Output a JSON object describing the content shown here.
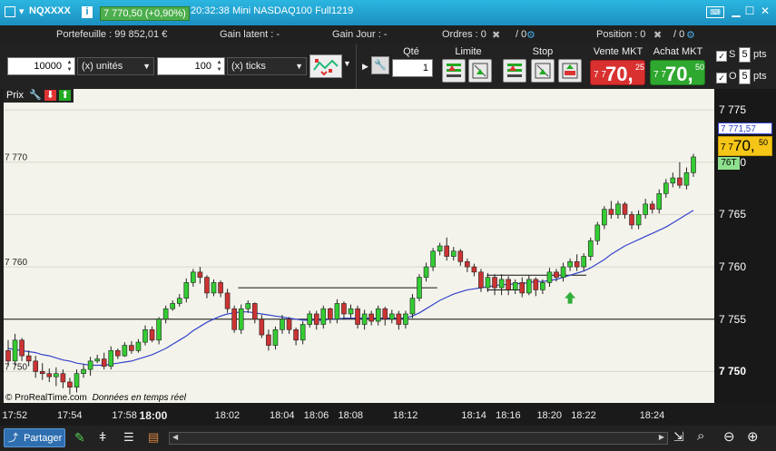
{
  "window": {
    "symbol": "NQXXXX",
    "price_badge": "7 770,50 (+0,90%)",
    "time": "20:32:38",
    "instrument": "Mini NASDAQ100 Full1219"
  },
  "account": {
    "portefeuille": "Portefeuille : 99 852,01 €",
    "gain_latent": "Gain latent : -",
    "gain_jour": "Gain Jour : -",
    "ordres": "Ordres : 0",
    "ordres2": "/ 0",
    "position": "Position : 0",
    "position2": "/ 0"
  },
  "toolbar": {
    "amount": "10000",
    "unit": "(x) unités",
    "ticks_value": "100",
    "ticks_unit": "(x) ticks",
    "qte_label": "Qté",
    "qte_value": "1",
    "limite_label": "Limite",
    "stop_label": "Stop",
    "vente_label": "Vente MKT",
    "vente_small": "7 7",
    "vente_big": "70,",
    "vente_sup": "25",
    "achat_label": "Achat MKT",
    "achat_small": "7 7",
    "achat_big": "70,",
    "achat_sup": "50",
    "s_label": "S",
    "s_value": "5",
    "o_label": "O",
    "o_value": "5",
    "pts": "pts"
  },
  "chart_panel": {
    "prix_label": "Prix",
    "credit": "© ProRealTime.com",
    "credit_live": "Données en temps réel",
    "price_tag_blue": "7 771,57",
    "price_tag_yellow_small": "7 7",
    "price_tag_yellow_big": "70,",
    "price_tag_yellow_sup": "50",
    "timer_tag": "76T"
  },
  "colors": {
    "up": "#33cc33",
    "down": "#cc3333",
    "ma": "#3344cc",
    "vente": "#d93030",
    "achat": "#2fa82f",
    "accent": "#1b8fc0"
  },
  "bottom": {
    "share_label": "Partager"
  },
  "chart_data": {
    "type": "candlestick",
    "ylim": [
      7747,
      7777
    ],
    "y_ticks": [
      {
        "v": 7775,
        "label": "7 775"
      },
      {
        "v": 7770,
        "label": "7 770"
      },
      {
        "v": 7765,
        "label": "7 765"
      },
      {
        "v": 7760,
        "label": "7 760"
      },
      {
        "v": 7755,
        "label": "7 755"
      },
      {
        "v": 7750,
        "label": "7 750"
      }
    ],
    "left_labels": [
      {
        "v": 7770,
        "label": "7 770"
      },
      {
        "v": 7760,
        "label": "7 760"
      },
      {
        "v": 7750,
        "label": "7 750"
      }
    ],
    "x_ticks": [
      {
        "i": 1,
        "label": "17:52"
      },
      {
        "i": 9,
        "label": "17:54"
      },
      {
        "i": 17,
        "label": "17:58"
      },
      {
        "i": 21,
        "label": "18:00"
      },
      {
        "i": 32,
        "label": "18:02"
      },
      {
        "i": 40,
        "label": "18:04"
      },
      {
        "i": 45,
        "label": "18:06"
      },
      {
        "i": 50,
        "label": "18:08"
      },
      {
        "i": 58,
        "label": "18:12"
      },
      {
        "i": 68,
        "label": "18:14"
      },
      {
        "i": 73,
        "label": "18:16"
      },
      {
        "i": 79,
        "label": "18:20"
      },
      {
        "i": 84,
        "label": "18:22"
      },
      {
        "i": 94,
        "label": "18:24"
      }
    ],
    "candles": [
      [
        7752.0,
        7751.0,
        7753.0,
        7750.5
      ],
      [
        7751.0,
        7753.0,
        7753.6,
        7750.6
      ],
      [
        7753.0,
        7751.5,
        7753.2,
        7751.0
      ],
      [
        7751.5,
        7751.0,
        7752.0,
        7750.5
      ],
      [
        7751.0,
        7750.0,
        7751.5,
        7749.4
      ],
      [
        7750.0,
        7749.8,
        7750.8,
        7749.2
      ],
      [
        7749.8,
        7749.5,
        7750.3,
        7749.0
      ],
      [
        7749.5,
        7749.8,
        7750.4,
        7748.6
      ],
      [
        7749.8,
        7749.0,
        7750.2,
        7748.4
      ],
      [
        7749.0,
        7748.5,
        7749.4,
        7747.8
      ],
      [
        7748.5,
        7749.8,
        7750.2,
        7748.0
      ],
      [
        7749.8,
        7750.2,
        7750.7,
        7749.4
      ],
      [
        7750.2,
        7751.0,
        7751.4,
        7749.6
      ],
      [
        7751.0,
        7751.2,
        7751.6,
        7750.8
      ],
      [
        7751.2,
        7750.5,
        7751.8,
        7750.2
      ],
      [
        7750.5,
        7752.0,
        7752.4,
        7750.2
      ],
      [
        7752.0,
        7751.5,
        7752.2,
        7751.2
      ],
      [
        7751.5,
        7752.5,
        7752.8,
        7751.4
      ],
      [
        7752.5,
        7752.0,
        7752.9,
        7751.7
      ],
      [
        7752.0,
        7752.8,
        7753.1,
        7751.8
      ],
      [
        7752.8,
        7754.0,
        7754.4,
        7752.5
      ],
      [
        7754.0,
        7753.0,
        7754.3,
        7752.8
      ],
      [
        7753.0,
        7755.0,
        7755.2,
        7752.6
      ],
      [
        7755.0,
        7756.0,
        7756.3,
        7754.6
      ],
      [
        7756.0,
        7756.5,
        7756.8,
        7755.8
      ],
      [
        7756.5,
        7757.0,
        7757.4,
        7756.2
      ],
      [
        7757.0,
        7758.5,
        7758.9,
        7756.6
      ],
      [
        7758.5,
        7759.5,
        7759.8,
        7758.1
      ],
      [
        7759.5,
        7759.0,
        7760.0,
        7758.4
      ],
      [
        7759.0,
        7757.5,
        7759.2,
        7757.0
      ],
      [
        7757.5,
        7758.5,
        7758.8,
        7757.2
      ],
      [
        7758.5,
        7757.5,
        7758.7,
        7757.1
      ],
      [
        7757.5,
        7756.0,
        7757.9,
        7755.6
      ],
      [
        7756.0,
        7754.0,
        7756.3,
        7753.7
      ],
      [
        7754.0,
        7756.0,
        7756.4,
        7753.6
      ],
      [
        7756.0,
        7756.5,
        7756.8,
        7755.6
      ],
      [
        7756.5,
        7755.0,
        7756.6,
        7754.6
      ],
      [
        7755.0,
        7753.5,
        7755.4,
        7753.2
      ],
      [
        7753.5,
        7752.5,
        7754.0,
        7752.0
      ],
      [
        7752.5,
        7754.0,
        7754.3,
        7752.1
      ],
      [
        7754.0,
        7755.0,
        7755.4,
        7753.6
      ],
      [
        7755.0,
        7754.0,
        7755.2,
        7753.6
      ],
      [
        7754.0,
        7753.0,
        7754.2,
        7752.5
      ],
      [
        7753.0,
        7754.5,
        7754.8,
        7752.6
      ],
      [
        7754.5,
        7755.5,
        7755.8,
        7754.2
      ],
      [
        7755.5,
        7754.5,
        7755.8,
        7754.0
      ],
      [
        7754.5,
        7756.0,
        7756.3,
        7754.1
      ],
      [
        7756.0,
        7755.0,
        7756.1,
        7754.6
      ],
      [
        7755.0,
        7756.5,
        7756.9,
        7754.6
      ],
      [
        7756.5,
        7755.5,
        7756.7,
        7755.0
      ],
      [
        7755.5,
        7756.0,
        7756.4,
        7755.1
      ],
      [
        7756.0,
        7754.5,
        7756.3,
        7754.1
      ],
      [
        7754.5,
        7755.5,
        7755.9,
        7754.0
      ],
      [
        7755.5,
        7754.8,
        7755.8,
        7754.4
      ],
      [
        7754.8,
        7756.0,
        7756.3,
        7754.4
      ],
      [
        7756.0,
        7755.0,
        7756.2,
        7754.4
      ],
      [
        7755.0,
        7755.5,
        7755.9,
        7754.6
      ],
      [
        7755.5,
        7754.5,
        7755.8,
        7754.0
      ],
      [
        7754.5,
        7755.5,
        7755.8,
        7754.1
      ],
      [
        7755.5,
        7757.0,
        7757.4,
        7755.1
      ],
      [
        7757.0,
        7759.0,
        7759.3,
        7756.7
      ],
      [
        7759.0,
        7760.0,
        7760.4,
        7758.6
      ],
      [
        7760.0,
        7761.5,
        7761.8,
        7759.6
      ],
      [
        7761.5,
        7762.0,
        7762.3,
        7761.1
      ],
      [
        7762.0,
        7761.0,
        7762.8,
        7760.6
      ],
      [
        7761.0,
        7761.5,
        7761.9,
        7760.6
      ],
      [
        7761.5,
        7760.5,
        7761.7,
        7760.1
      ],
      [
        7760.5,
        7760.0,
        7760.8,
        7759.5
      ],
      [
        7760.0,
        7759.5,
        7760.3,
        7759.1
      ],
      [
        7759.5,
        7758.0,
        7759.8,
        7757.6
      ],
      [
        7758.0,
        7759.0,
        7759.4,
        7757.6
      ],
      [
        7759.0,
        7758.0,
        7759.3,
        7757.3
      ],
      [
        7758.0,
        7758.8,
        7759.3,
        7757.3
      ],
      [
        7758.8,
        7757.8,
        7759.1,
        7757.3
      ],
      [
        7757.8,
        7758.5,
        7758.8,
        7757.4
      ],
      [
        7758.5,
        7757.5,
        7759.0,
        7757.1
      ],
      [
        7757.5,
        7758.8,
        7759.2,
        7757.3
      ],
      [
        7758.8,
        7757.8,
        7759.0,
        7757.2
      ],
      [
        7757.8,
        7758.5,
        7758.8,
        7757.4
      ],
      [
        7758.5,
        7759.5,
        7759.9,
        7758.1
      ],
      [
        7759.5,
        7759.0,
        7759.8,
        7758.6
      ],
      [
        7759.0,
        7760.0,
        7760.4,
        7758.6
      ],
      [
        7760.0,
        7760.5,
        7760.8,
        7759.6
      ],
      [
        7760.5,
        7760.0,
        7761.2,
        7759.6
      ],
      [
        7760.0,
        7761.0,
        7761.3,
        7759.6
      ],
      [
        7761.0,
        7762.5,
        7762.8,
        7760.6
      ],
      [
        7762.5,
        7764.0,
        7764.3,
        7762.1
      ],
      [
        7764.0,
        7765.5,
        7765.8,
        7763.6
      ],
      [
        7765.5,
        7765.0,
        7766.3,
        7764.6
      ],
      [
        7765.0,
        7766.0,
        7766.3,
        7764.6
      ],
      [
        7766.0,
        7765.0,
        7766.2,
        7764.6
      ],
      [
        7765.0,
        7764.0,
        7765.3,
        7763.6
      ],
      [
        7764.0,
        7765.0,
        7765.4,
        7763.6
      ],
      [
        7765.0,
        7766.0,
        7766.5,
        7764.6
      ],
      [
        7766.0,
        7765.5,
        7766.3,
        7765.1
      ],
      [
        7765.5,
        7767.0,
        7767.4,
        7765.1
      ],
      [
        7767.0,
        7768.0,
        7768.4,
        7766.6
      ],
      [
        7768.0,
        7768.5,
        7769.0,
        7767.6
      ],
      [
        7768.5,
        7767.8,
        7770.0,
        7767.5
      ],
      [
        7767.8,
        7769.0,
        7769.5,
        7767.4
      ],
      [
        7769.0,
        7770.5,
        7770.8,
        7768.6
      ]
    ],
    "moving_average": [
      7752.2,
      7752.1,
      7752.0,
      7751.9,
      7751.8,
      7751.6,
      7751.5,
      7751.3,
      7751.1,
      7751.0,
      7750.8,
      7750.7,
      7750.6,
      7750.6,
      7750.6,
      7750.7,
      7750.8,
      7750.9,
      7751.0,
      7751.2,
      7751.4,
      7751.6,
      7751.9,
      7752.2,
      7752.6,
      7753.0,
      7753.4,
      7753.9,
      7754.3,
      7754.7,
      7755.0,
      7755.3,
      7755.5,
      7755.6,
      7755.7,
      7755.7,
      7755.6,
      7755.5,
      7755.4,
      7755.3,
      7755.2,
      7755.1,
      7755.0,
      7754.9,
      7754.9,
      7754.9,
      7754.9,
      7755.0,
      7755.0,
      7755.1,
      7755.1,
      7755.1,
      7755.1,
      7755.1,
      7755.1,
      7755.1,
      7755.1,
      7755.1,
      7755.1,
      7755.3,
      7755.6,
      7756.0,
      7756.4,
      7756.8,
      7757.1,
      7757.4,
      7757.6,
      7757.8,
      7757.9,
      7758.0,
      7758.1,
      7758.2,
      7758.3,
      7758.3,
      7758.4,
      7758.4,
      7758.5,
      7758.6,
      7758.6,
      7758.7,
      7758.8,
      7759.0,
      7759.2,
      7759.4,
      7759.6,
      7759.9,
      7760.3,
      7760.7,
      7761.2,
      7761.6,
      7762.0,
      7762.3,
      7762.6,
      7762.9,
      7763.2,
      7763.5,
      7763.8,
      7764.2,
      7764.6,
      7765.0,
      7765.4
    ],
    "horizontal_lines": [
      {
        "v": 7755.0,
        "from": 0,
        "to": 1
      },
      {
        "v": 7758.0,
        "from": 0.33,
        "to": 0.61
      },
      {
        "v": 7757.8,
        "from": 0.68,
        "to": 0.73
      },
      {
        "v": 7759.2,
        "from": 0.68,
        "to": 0.82
      }
    ],
    "arrows": [
      {
        "i": 82,
        "v": 7757.0
      }
    ]
  }
}
